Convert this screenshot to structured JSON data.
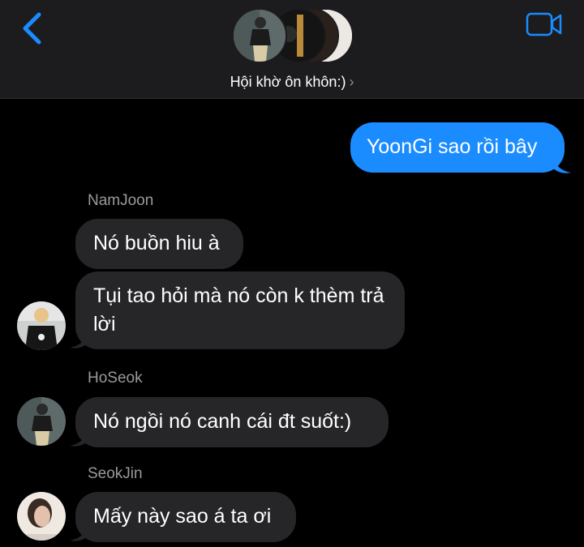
{
  "header": {
    "group_name": "Hội khờ ôn khôn:)",
    "chevron": "›",
    "back_icon": "chevron-left-icon",
    "video_icon": "video-camera-icon",
    "accent_color": "#1a8cff"
  },
  "messages": [
    {
      "direction": "outgoing",
      "text": "YoonGi sao rồi bây"
    },
    {
      "sender": "NamJoon",
      "direction": "incoming",
      "text": "Nó buồn hiu à"
    },
    {
      "sender": "NamJoon",
      "direction": "incoming",
      "text": "Tụi tao hỏi mà nó còn k thèm trả lời"
    },
    {
      "sender": "HoSeok",
      "direction": "incoming",
      "text": "Nó ngồi nó canh cái đt suốt:)"
    },
    {
      "sender": "SeokJin",
      "direction": "incoming",
      "text": "Mấy này sao á ta ơi"
    }
  ]
}
